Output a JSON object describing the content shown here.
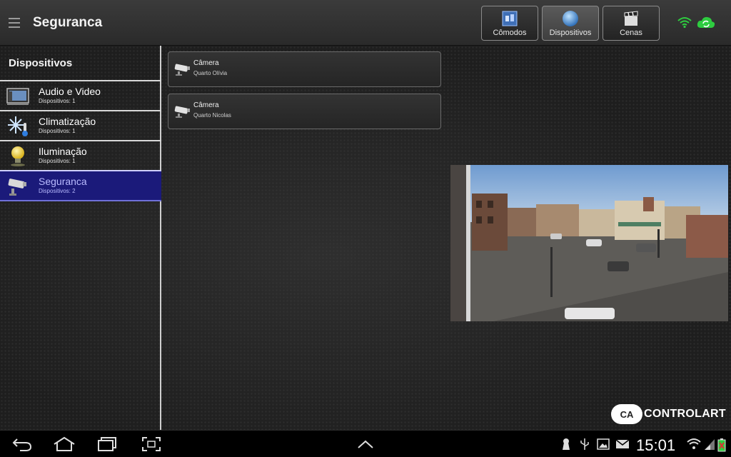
{
  "topbar": {
    "title": "Seguranca",
    "nav": [
      {
        "label": "Cômodos",
        "icon": "rooms-icon"
      },
      {
        "label": "Dispositivos",
        "icon": "globe-icon",
        "active": true
      },
      {
        "label": "Cenas",
        "icon": "clapperboard-icon"
      }
    ]
  },
  "sidebar": {
    "header": "Dispositivos",
    "items": [
      {
        "name": "Audio e Video",
        "count": "Dispositivos: 1",
        "icon": "audio-video-icon"
      },
      {
        "name": "Climatização",
        "count": "Dispositivos: 1",
        "icon": "snowflake-thermometer-icon"
      },
      {
        "name": "Iluminação",
        "count": "Dispositivos: 1",
        "icon": "light-bulb-icon"
      },
      {
        "name": "Seguranca",
        "count": "Dispositivos: 2",
        "icon": "security-camera-icon",
        "selected": true
      }
    ]
  },
  "devices": [
    {
      "name": "Câmera",
      "room": "Quarto Olívia"
    },
    {
      "name": "Câmera",
      "room": "Quarto Nicolas"
    }
  ],
  "brand": {
    "mark": "CA",
    "word": "CONTROLART"
  },
  "system": {
    "time": "15:01"
  },
  "colors": {
    "accent": "#1b1a7a",
    "status_green": "#2ecc40"
  }
}
